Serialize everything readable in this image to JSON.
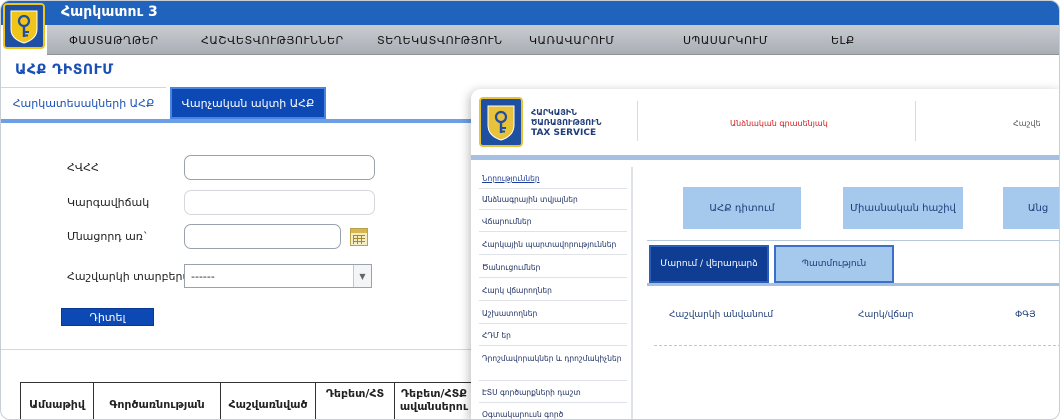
{
  "app": {
    "title": "Հարկատու 3"
  },
  "menu": [
    {
      "label": "ՓԱՍՏԱԹՂԹԵՐ"
    },
    {
      "label": "ՀԱՇՎԵՏՎՈՒԹՅՈՒՆՆԵՐ"
    },
    {
      "label": "ՏԵՂԵԿԱՏՎՈՒԹՅՈՒՆ"
    },
    {
      "label": "ԿԱՌԱՎԱՐՈՒՄ"
    },
    {
      "label": "ՍՊԱՍԱՐԿՈՒՄ"
    },
    {
      "label": "ԵԼՔ"
    }
  ],
  "page": {
    "title": "ԱՀՔ ԴԻՏՈՒՄ"
  },
  "tabs": [
    {
      "label": "Հարկատեսակների ԱՀՔ"
    },
    {
      "label": "Վարչական ակտի ԱՀՔ"
    }
  ],
  "form": {
    "tin_label": "ՀՎՀՀ",
    "tin_value": "",
    "status_label": "Կարգավիճակ",
    "status_value": "",
    "date_label": "Մնացորդ առ`",
    "date_value": "",
    "account_type_label": "Հաշվարկի տարբերակ",
    "account_type_value": "------",
    "search_label": "Դիտել"
  },
  "results_table": {
    "headers": [
      "Ամսաթիվ",
      "Գործառնության",
      "Հաշվառնված",
      "Դեբետ/ՀՏ",
      "Դեբետ/ՀՏՔ ավանսերու"
    ]
  },
  "overlay": {
    "org_lines": [
      "ՀԱՐԿԱՅԻՆ",
      "ԾԱՌԱՅՈՒԹՅՈՒՆ",
      "TAX SERVICE"
    ],
    "banner": "Անձնական գրասենյակ",
    "right_text": "Հաշվե",
    "side_menu": [
      "Նորություններ",
      "Անձնագրային տվյալներ",
      "Վճարումներ",
      "Հարկային պարտավորություններ",
      "Ծանուցումներ",
      "Հարկ վճարողներ",
      "Աշխատողներ",
      "ՀԴՄ եր",
      "Դրոշմավորակներ և դրոշմակիչներ",
      "ԷՏՍ գործարքների դաշտ",
      "Օգտակարուսն գործ"
    ],
    "buttons": [
      "ԱՀՔ դիտում",
      "Միասնական հաշիվ",
      "Անց"
    ],
    "tabs": [
      "Մարում / վերադարձ",
      "Պատմություն"
    ],
    "columns": [
      "Հաշվարկի անվանում",
      "Հարկ/վճար",
      "ՓԳՅ"
    ]
  },
  "colors": {
    "primary": "#1f63bd",
    "tab_active": "#0d49b5",
    "menubar": "#b9bdc2",
    "light_button": "#a5c8ed",
    "banner_red": "#d0201e"
  },
  "icons": [
    "emblem-logo",
    "calendar-icon",
    "chevron-down-icon"
  ]
}
